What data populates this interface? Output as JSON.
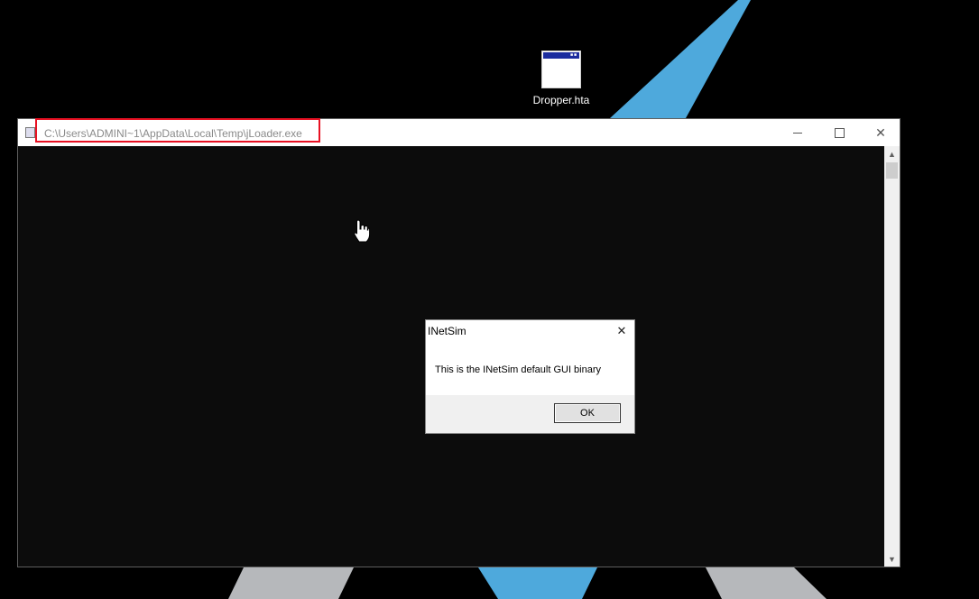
{
  "desktop": {
    "icon_label": "Dropper.hta"
  },
  "console": {
    "title": "C:\\Users\\ADMINI~1\\AppData\\Local\\Temp\\jLoader.exe",
    "controls": {
      "minimize": "–",
      "maximize": "□",
      "close": "✕"
    }
  },
  "dialog": {
    "title": "INetSim",
    "message": "This is the INetSim default GUI binary",
    "ok_label": "OK",
    "close_glyph": "✕"
  },
  "colors": {
    "wallpaper_blue": "#4ea9dc",
    "wallpaper_gray": "#b6b8bb",
    "highlight_red": "#e81123"
  }
}
